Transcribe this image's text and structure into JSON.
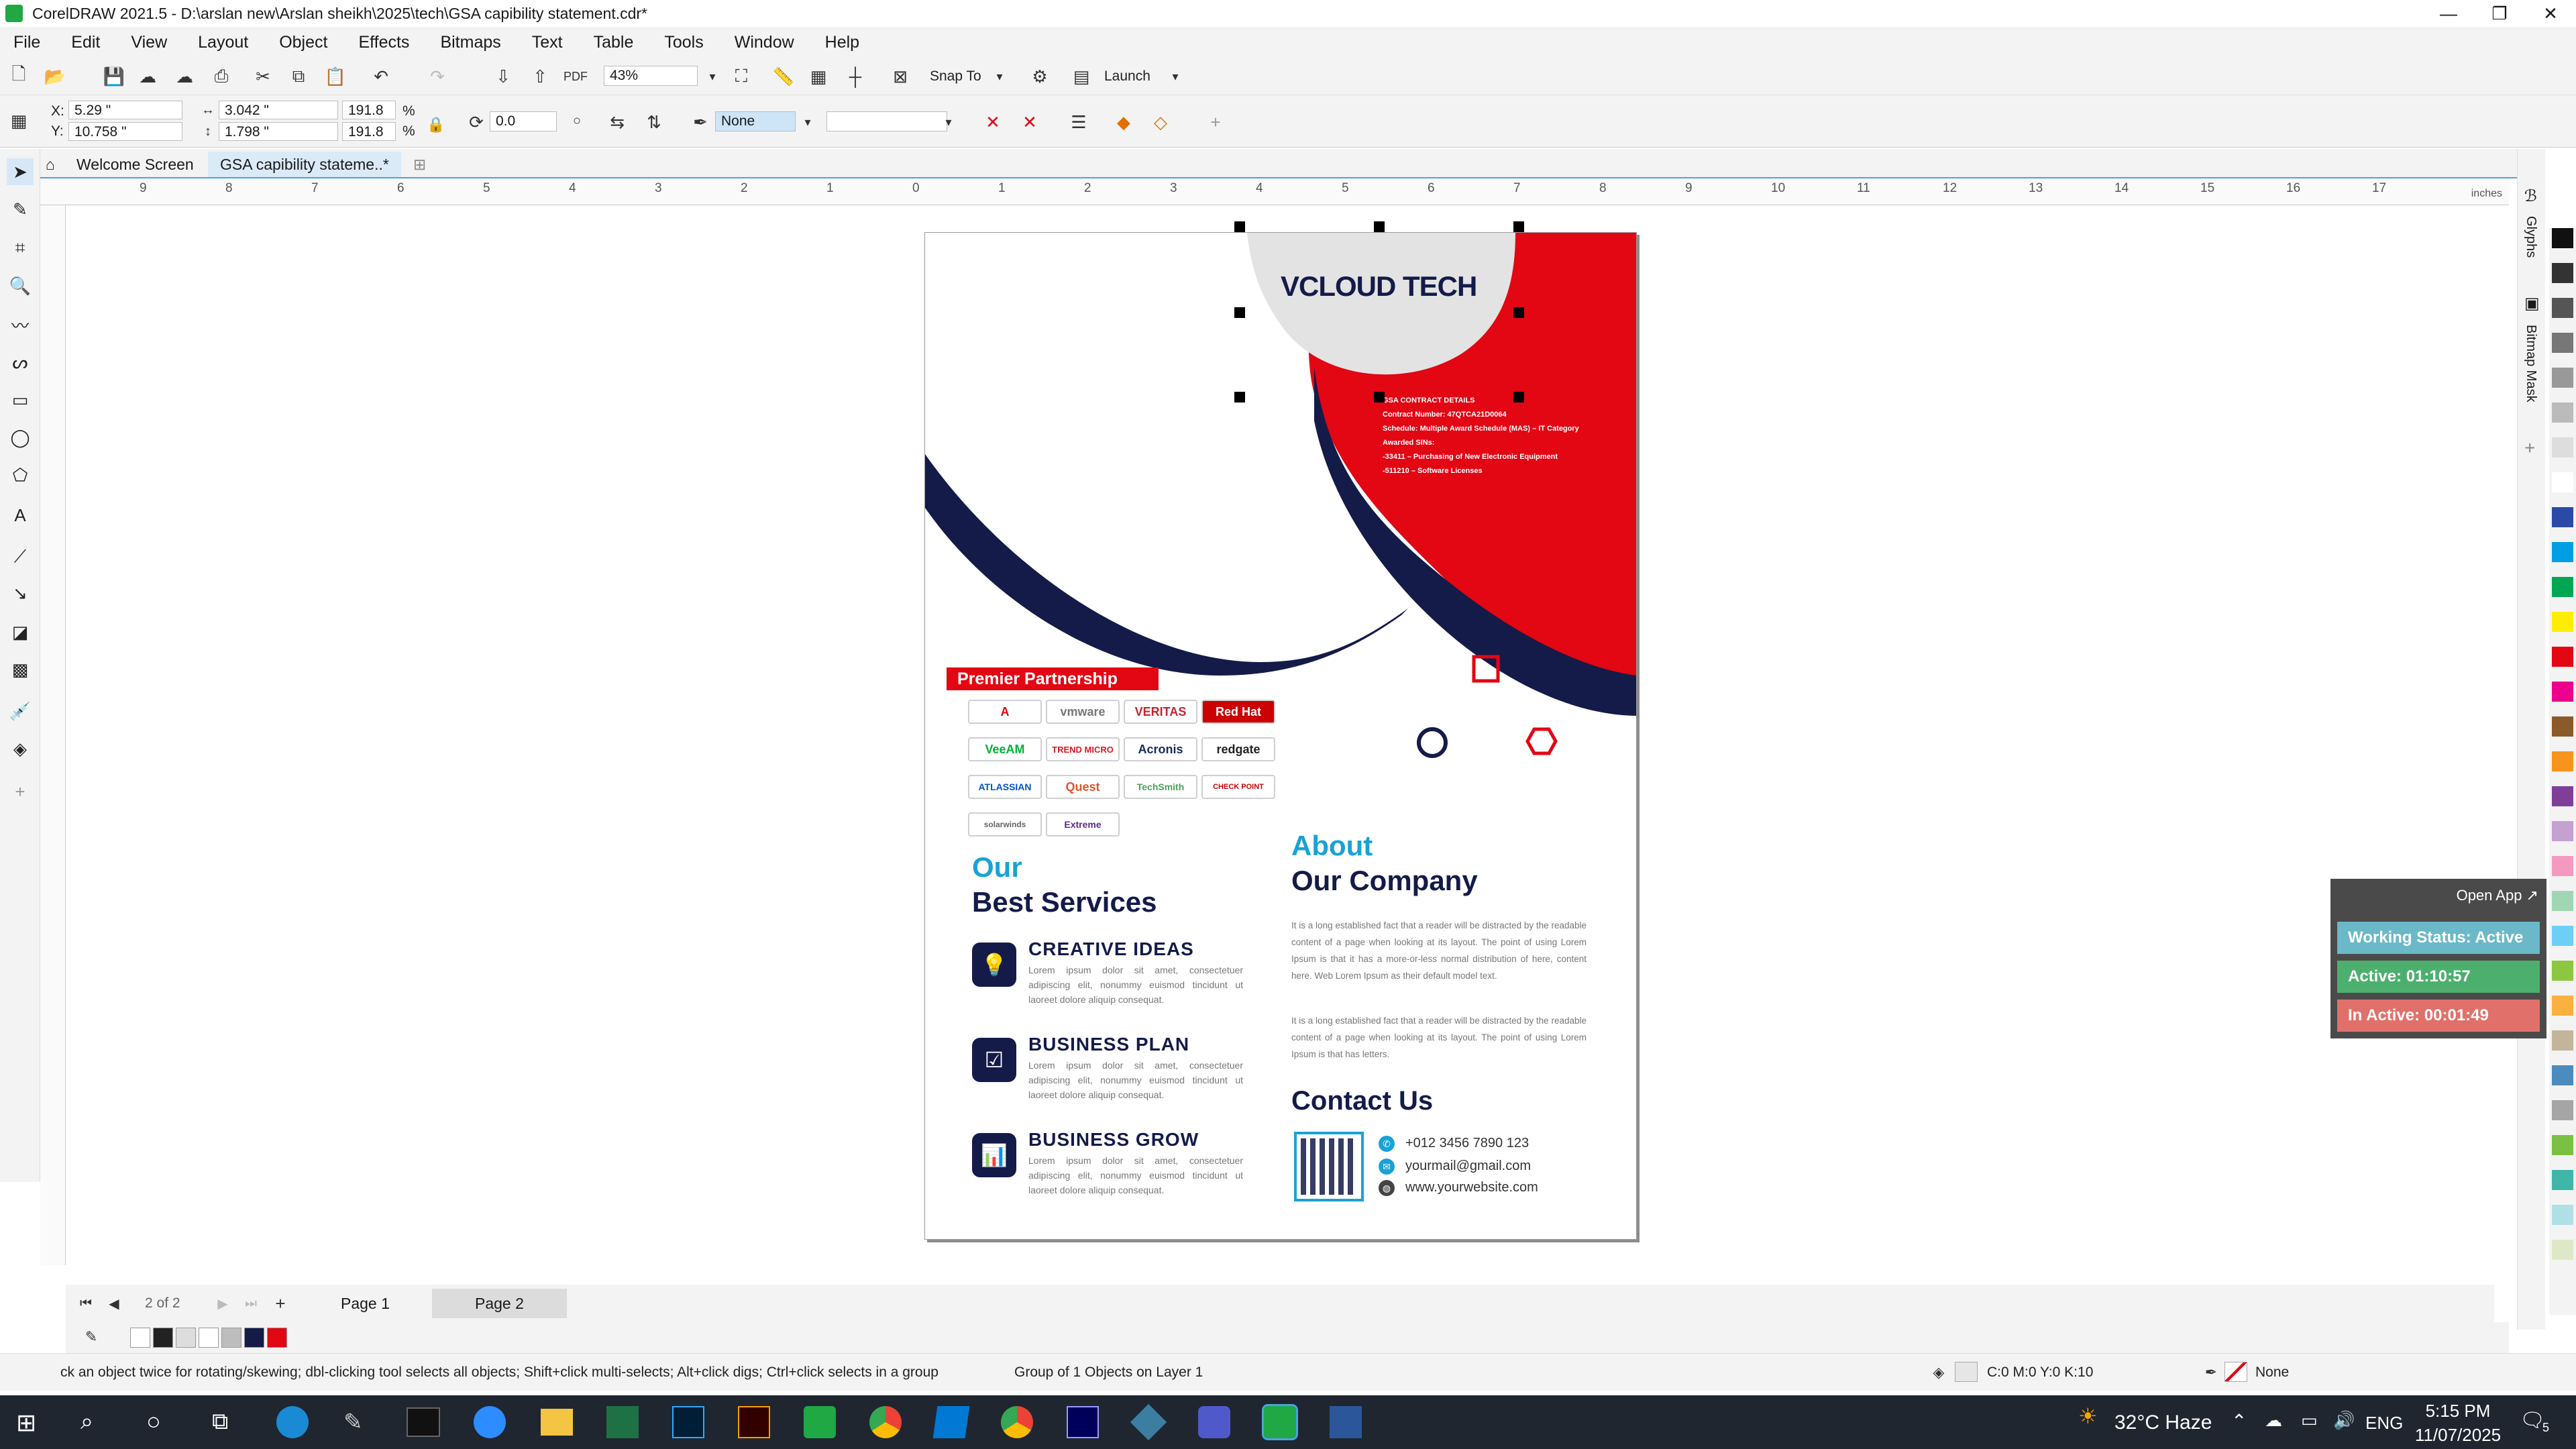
{
  "window": {
    "title": "CorelDRAW 2021.5 - D:\\arslan new\\Arslan sheikh\\2025\\tech\\GSA  capibility statement.cdr*",
    "controls": [
      "—",
      "❐",
      "✕"
    ]
  },
  "menu": [
    "File",
    "Edit",
    "View",
    "Layout",
    "Object",
    "Effects",
    "Bitmaps",
    "Text",
    "Table",
    "Tools",
    "Window",
    "Help"
  ],
  "toolbar": {
    "zoom": "43%",
    "snap_to": "Snap To",
    "launch": "Launch"
  },
  "property_bar": {
    "x_label": "X:",
    "x": "5.29 \"",
    "y_label": "Y:",
    "y": "10.758 \"",
    "w": "3.042 \"",
    "h": "1.798 \"",
    "scale_w": "191.8",
    "scale_h": "191.8",
    "pct": "%",
    "rotation": "0.0",
    "outline": "None"
  },
  "tabs": {
    "welcome": "Welcome Screen",
    "doc": "GSA  capibility stateme..*"
  },
  "rulers": {
    "h_ticks": [
      "9",
      "8",
      "7",
      "6",
      "5",
      "4",
      "3",
      "2",
      "1",
      "0",
      "1",
      "2",
      "3",
      "4",
      "5",
      "6",
      "7",
      "8",
      "9",
      "10",
      "11",
      "12",
      "13",
      "14",
      "15",
      "16",
      "17"
    ],
    "unit": "inches"
  },
  "document": {
    "logo_text": "VCLOUD TECH",
    "gsa": {
      "title": "GSA CONTRACT DETAILS",
      "lines": [
        "Contract Number: 47QTCA21D0064",
        "Schedule: Multiple Award Schedule (MAS) – IT Category",
        "Awarded SINs:",
        "-33411 – Purchasing of New Electronic Equipment",
        "-511210 – Software Licenses"
      ]
    },
    "partnership": "Premier Partnership",
    "partner_logos": [
      "A",
      "vmware",
      "VERITAS",
      "Red Hat",
      "VeeAM",
      "TREND MICRO",
      "Acronis",
      "redgate",
      "ATLASSIAN",
      "Quest",
      "TechSmith",
      "CHECK POINT",
      "solarwinds",
      "Extreme"
    ],
    "services_heading_1": "Our",
    "services_heading_2": "Best Services",
    "services": [
      {
        "title": "CREATIVE IDEAS",
        "text": "Lorem ipsum dolor sit amet, consectetuer adipiscing elit, nonummy euismod tincidunt ut laoreet dolore aliquip consequat."
      },
      {
        "title": "BUSINESS PLAN",
        "text": "Lorem ipsum dolor sit amet, consectetuer adipiscing elit, nonummy euismod tincidunt ut laoreet dolore aliquip consequat."
      },
      {
        "title": "BUSINESS GROW",
        "text": "Lorem ipsum dolor sit amet, consectetuer adipiscing elit, nonummy euismod tincidunt ut laoreet dolore aliquip consequat."
      }
    ],
    "about_heading_1": "About",
    "about_heading_2": "Our Company",
    "about_p1": "It is a long established fact that a reader will be distracted by the readable content of a page when looking at its layout. The point of using Lorem Ipsum is that it has a more-or-less normal distribution of here, content here. Web Lorem Ipsum as their default model text.",
    "about_p2": "It is a long established fact that a reader will be distracted by the readable content of a page when looking at its layout. The point of using Lorem Ipsum is that has letters.",
    "contact_heading": "Contact Us",
    "contact": {
      "phone": "+012 3456 7890 123",
      "email": "yourmail@gmail.com",
      "web": "www.yourwebsite.com"
    }
  },
  "widget": {
    "open_app": "Open App ↗",
    "status": "Working Status: Active",
    "active": "Active: 01:10:57",
    "inactive": "In Active: 00:01:49",
    "colors": {
      "status": "#6bb8c8",
      "active": "#4caf6e",
      "inactive": "#e2706a"
    }
  },
  "dockers": [
    "Glyphs",
    "Bitmap Mask"
  ],
  "pagenav": {
    "counter": "2 of 2",
    "pages": [
      "Page 1",
      "Page 2"
    ]
  },
  "document_palette": [
    "#ffffff",
    "#222222",
    "#dddddd",
    "#ffffff",
    "#bdbdbd",
    "#141b49",
    "#e30613"
  ],
  "palette": [
    "#111111",
    "#333333",
    "#555555",
    "#777777",
    "#999999",
    "#bbbbbb",
    "#dddddd",
    "#ffffff",
    "#2b4aa8",
    "#009ee3",
    "#00a651",
    "#ffed00",
    "#e30613",
    "#ec008c",
    "#8b5a2b",
    "#f7941d",
    "#7f3f98",
    "#c4a1d0",
    "#f49ac1",
    "#a0d6b4",
    "#6dcff6",
    "#8dc63f",
    "#fbb040",
    "#c2b59b",
    "#4b8bbe",
    "#a5a5a5",
    "#7ac143",
    "#3fb6a8",
    "#b0e0e6",
    "#dfe8c6"
  ],
  "status": {
    "hint": "ck an object twice for rotating/skewing; dbl-clicking tool selects all objects; Shift+click multi-selects; Alt+click digs; Ctrl+click selects in a group",
    "selection": "Group of 1 Objects on Layer 1",
    "fill": "C:0 M:0 Y:0 K:10",
    "outline": "None"
  },
  "taskbar": {
    "weather": "32°C  Haze",
    "lang": "ENG",
    "time": "5:15 PM",
    "date": "11/07/2025",
    "notifications": "5"
  }
}
